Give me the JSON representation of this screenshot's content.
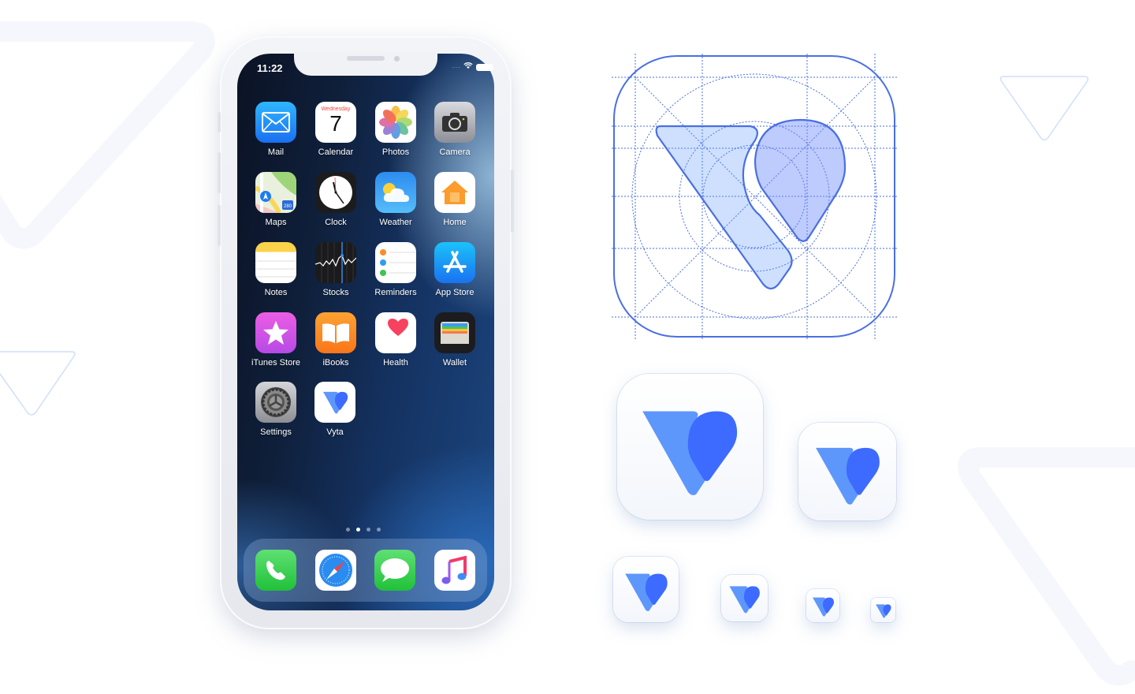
{
  "colors": {
    "accent_blue": "#3d6bff",
    "light_blue": "#5e97fb",
    "grid_line": "#4a6fe3",
    "bg_triangle": "#f5f7fc",
    "outline_triangle": "#d0defb"
  },
  "phone": {
    "status_bar": {
      "time": "11:22",
      "icons": [
        "signal-dots-icon",
        "wifi-icon",
        "battery-icon"
      ]
    },
    "home_screen": {
      "apps": [
        {
          "label": "Mail",
          "icon": "mail-icon"
        },
        {
          "label": "Calendar",
          "icon": "calendar-icon",
          "day_name": "Wednesday",
          "day_number": "7"
        },
        {
          "label": "Photos",
          "icon": "photos-icon"
        },
        {
          "label": "Camera",
          "icon": "camera-icon"
        },
        {
          "label": "Maps",
          "icon": "maps-icon",
          "badge": "280"
        },
        {
          "label": "Clock",
          "icon": "clock-icon"
        },
        {
          "label": "Weather",
          "icon": "weather-icon"
        },
        {
          "label": "Home",
          "icon": "home-icon"
        },
        {
          "label": "Notes",
          "icon": "notes-icon"
        },
        {
          "label": "Stocks",
          "icon": "stocks-icon"
        },
        {
          "label": "Reminders",
          "icon": "reminders-icon"
        },
        {
          "label": "App Store",
          "icon": "app-store-icon"
        },
        {
          "label": "iTunes Store",
          "icon": "itunes-store-icon"
        },
        {
          "label": "iBooks",
          "icon": "ibooks-icon"
        },
        {
          "label": "Health",
          "icon": "health-icon"
        },
        {
          "label": "Wallet",
          "icon": "wallet-icon"
        },
        {
          "label": "Settings",
          "icon": "settings-icon"
        },
        {
          "label": "Vyta",
          "icon": "vyta-icon"
        }
      ],
      "page_indicator": {
        "total": 4,
        "current": 2
      }
    },
    "dock": [
      {
        "label": "Phone",
        "icon": "phone-icon"
      },
      {
        "label": "Safari",
        "icon": "safari-icon"
      },
      {
        "label": "Messages",
        "icon": "messages-icon"
      },
      {
        "label": "Music",
        "icon": "music-icon"
      }
    ]
  },
  "icon_showcase": {
    "construction_grid": {
      "name": "vyta-icon-grid"
    },
    "sizes": [
      "xl",
      "lg",
      "md",
      "sm",
      "xs",
      "xxs"
    ]
  }
}
